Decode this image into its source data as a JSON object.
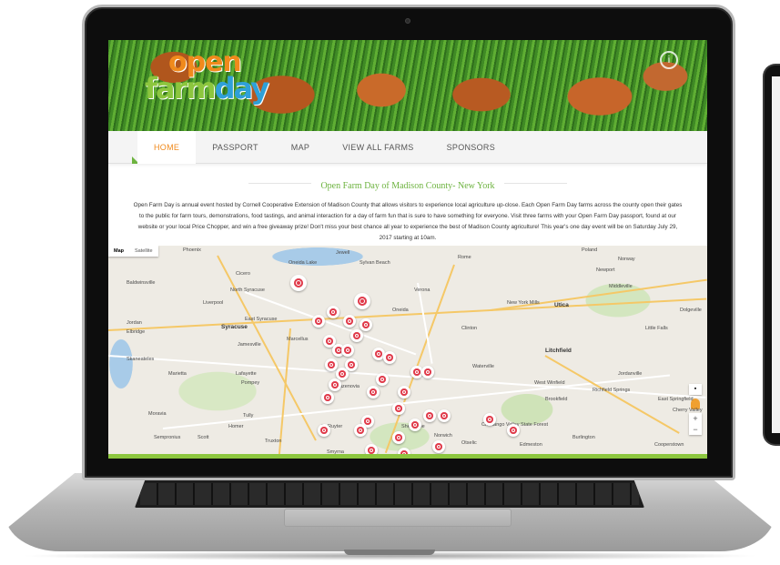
{
  "site": {
    "logo_line1": "open",
    "logo_line2a": "farm",
    "logo_line2b": "day"
  },
  "nav": {
    "items": [
      "HOME",
      "PASSPORT",
      "MAP",
      "VIEW ALL FARMS",
      "SPONSORS"
    ],
    "active": "HOME"
  },
  "page": {
    "title": "Open Farm Day of Madison County- New York",
    "intro": "Open Farm Day is annual event hosted by Cornell Cooperative Extension of Madison County that allows visitors to experience local agriculture up-close. Each Open Farm Day farms across the county open their gates to the public for farm tours, demonstrations, food tastings, and animal interaction for a day of farm fun that is sure to have something for everyone. Visit three farms with your Open Farm Day passport, found at our website or your local Price Chopper, and win a free giveaway prize! Don't miss your best chance all year to experience the best of Madison County agriculture! This year's one day event will be on Saturday July 29, 2017 starting at 10am."
  },
  "map": {
    "tabs": [
      "Map",
      "Satellite"
    ],
    "active_tab": "Map",
    "labels": [
      "Phoenix",
      "Oneida Lake",
      "Jewell",
      "Sylvan Beach",
      "Rome",
      "Poland",
      "Norway",
      "Newport",
      "Baldwinsville",
      "Cicero",
      "North Syracuse",
      "Verona",
      "Middleville",
      "Liverpool",
      "Syracuse",
      "East Syracuse",
      "Oneida",
      "New York Mills",
      "Utica",
      "Dolgeville",
      "Jordan",
      "Elbridge",
      "Jamesville",
      "Marcellus",
      "Clinton",
      "Little Falls",
      "Litchfield",
      "Skaneateles",
      "Marietta",
      "Lafayette",
      "Pompey",
      "Waterville",
      "Jordanville",
      "West Winfield",
      "Richfield Springs",
      "Cherry Valley",
      "Cazenovia",
      "Moravia",
      "Sempronius",
      "Scott",
      "Homer",
      "Tully",
      "Truxton",
      "DeRuyter",
      "Smyrna",
      "Sherburne",
      "Norwich",
      "Chenango Valley State Forest",
      "Otselic",
      "Edmeston",
      "Burlington",
      "Cooperstown",
      "Brookfield",
      "East Springfield"
    ],
    "controls": {
      "zoom_in": "+",
      "zoom_out": "−"
    }
  },
  "colors": {
    "accent_orange": "#f08a1c",
    "accent_green": "#6db33f",
    "logo_blue": "#2fa0d8",
    "pin_red": "#e03a4a"
  }
}
